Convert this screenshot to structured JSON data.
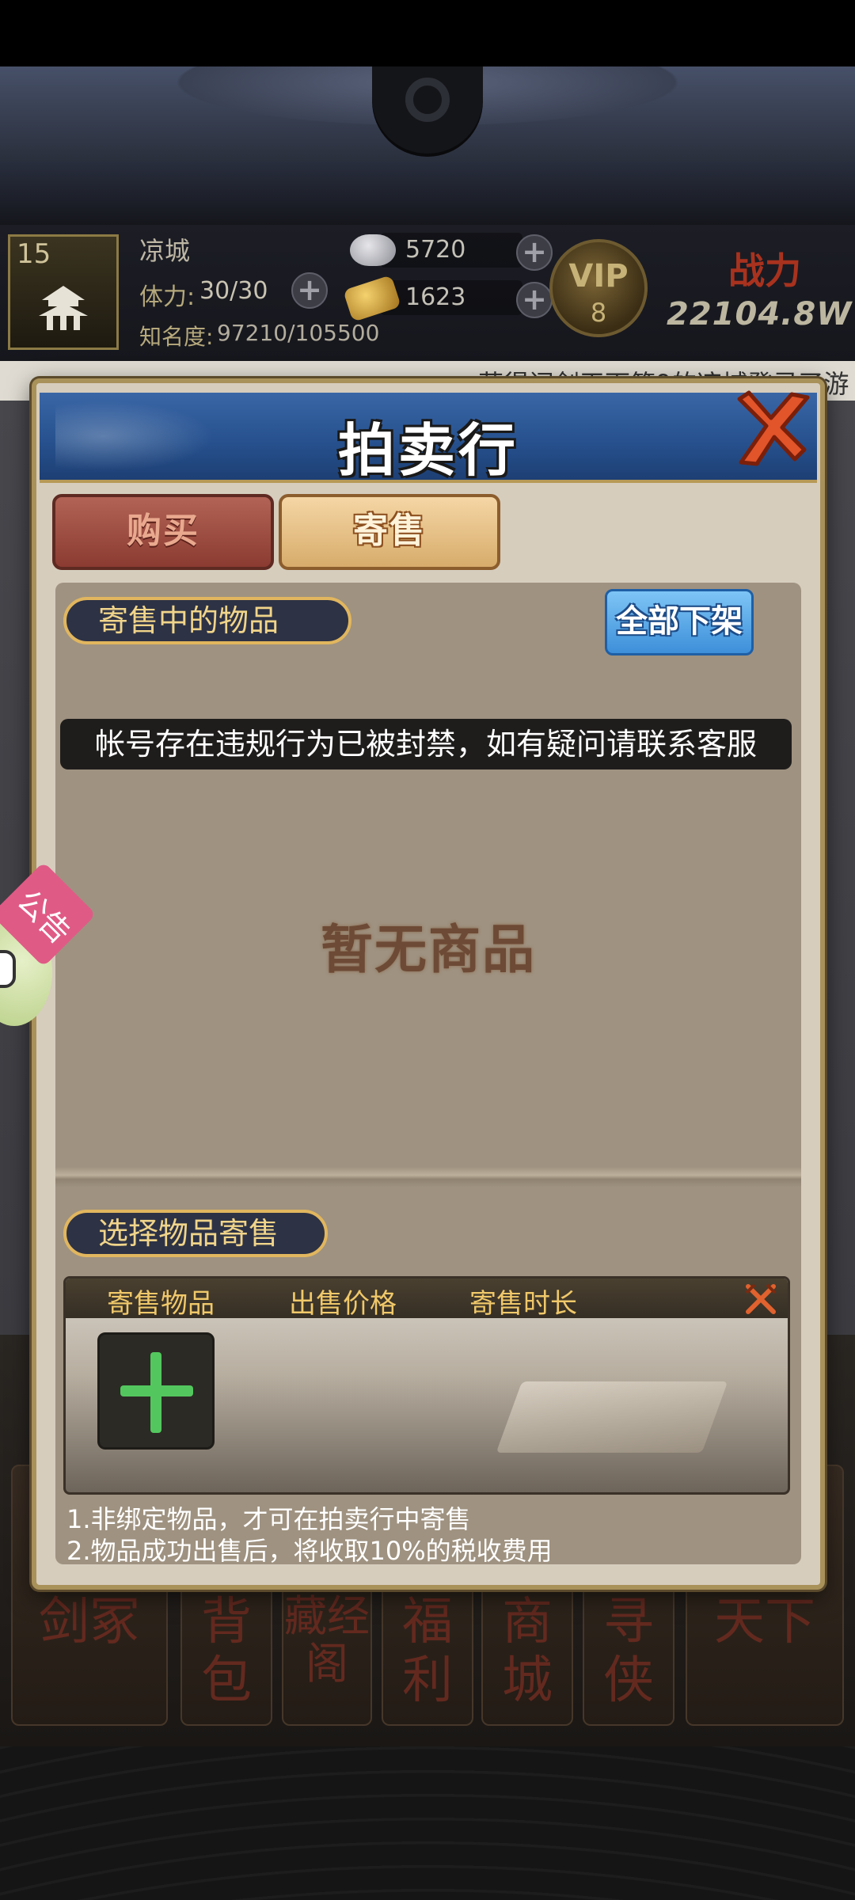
{
  "player": {
    "city_level": "15",
    "city_name": "凉城",
    "stamina_label": "体力:",
    "stamina_value": "30/30",
    "fame_label": "知名度:",
    "fame_value": "97210/105500",
    "silver": "5720",
    "gold": "1623",
    "vip_label": "VIP",
    "vip_level": "8",
    "power_label": "战力",
    "power_value": "22104.8W"
  },
  "ticker": {
    "text": "获得问剑天下第9的凉城登录了游"
  },
  "notice": {
    "label": "公告"
  },
  "bottom_nav": [
    "剑冢",
    "背包",
    "藏经阁",
    "福利",
    "商城",
    "寻侠",
    "天下"
  ],
  "dialog": {
    "title": "拍卖行",
    "tabs": [
      {
        "label": "购买",
        "active": false
      },
      {
        "label": "寄售",
        "active": true
      }
    ],
    "on_shelf_label": "寄售中的物品",
    "unlist_all_label": "全部下架",
    "ban_message": "帐号存在违规行为已被封禁，如有疑问请联系客服",
    "empty_text": "暂无商品",
    "select_label": "选择物品寄售",
    "columns": [
      "寄售物品",
      "出售价格",
      "寄售时长"
    ],
    "rules": [
      "1.非绑定物品，才可在拍卖行中寄售",
      "2.物品成功出售后，将收取10%的税收费用"
    ]
  },
  "colors": {
    "dialog_header": "#27528f",
    "tab_buy": "#8b3b31",
    "tab_consign": "#d7ac6b",
    "unlist_button": "#3d8fd9",
    "add_plus": "#53c75e",
    "section_label_text": "#f0d48a"
  },
  "icons": [
    "pagoda-icon",
    "silver-ingot-icon",
    "gold-ingot-icon",
    "plus-icon",
    "vip-badge-icon",
    "close-x-icon",
    "crossed-swords-icon",
    "robot-helper-icon"
  ]
}
